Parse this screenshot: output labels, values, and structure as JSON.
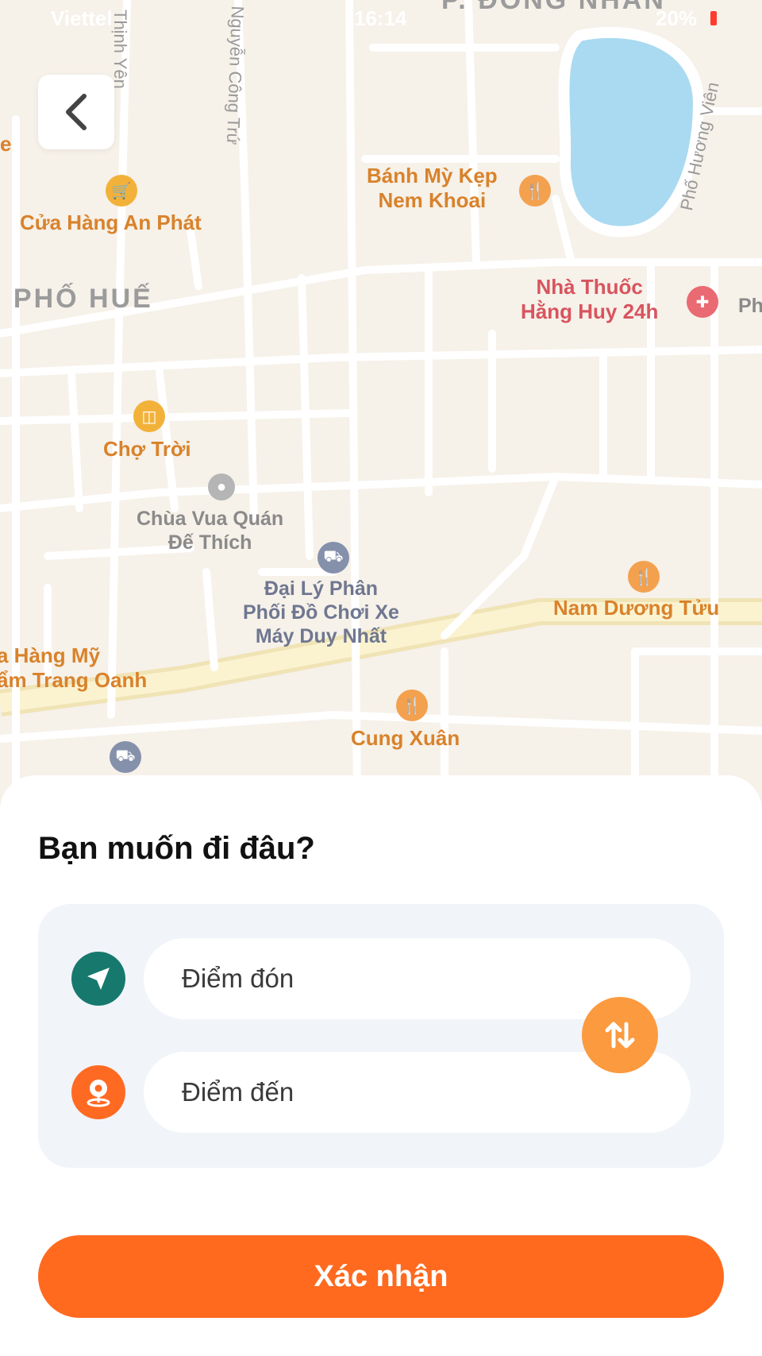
{
  "status_bar": {
    "carrier": "Viettel",
    "time": "16:14",
    "battery": "20%"
  },
  "map": {
    "labels": {
      "district_north": "P. ĐỒNG NHÂN",
      "district_west": ". PHỐ HUẾ",
      "street_thinh_yen": "Thịnh Yên",
      "street_nguyen_cong_tru": "Nguyễn Công Trứ",
      "street_huong_vien": "Phố Hương Viên",
      "edge_left_e": "e",
      "edge_right_ph": "Ph",
      "poi_an_phat": "Cửa Hàng An Phát",
      "poi_banh_my": "Bánh Mỳ Kẹp\nNem Khoai",
      "poi_nha_thuoc": "Nhà Thuốc\nHằng Huy 24h",
      "poi_cho_troi": "Chợ Trời",
      "poi_chua": "Chùa Vua Quán\nĐế Thích",
      "poi_dai_ly": "Đại Lý Phân\nPhối Đồ Chơi Xe\nMáy Duy Nhất",
      "poi_nam_duong": "Nam Dương Tửu",
      "poi_hang_my": "a Hàng Mỹ\nẩm Trang Oanh",
      "poi_cung_xuan": "Cung Xuân"
    }
  },
  "back_button": {
    "icon": "chevron-left-icon"
  },
  "sheet": {
    "title": "Bạn muốn đi đâu?",
    "pickup": {
      "placeholder": "Điểm đón",
      "value": "",
      "icon": "navigation-arrow-icon"
    },
    "destination": {
      "placeholder": "Điểm đến",
      "value": "",
      "icon": "location-pin-icon"
    },
    "swap_icon": "swap-arrows-icon",
    "confirm_label": "Xác nhận"
  },
  "colors": {
    "accent": "#ff6a1f",
    "pickup_icon_bg": "#17796d",
    "destination_icon_bg": "#ff6a23",
    "swap_bg": "#fb9a3f",
    "lake": "#a9daf1",
    "map_bg": "#f6f1e9"
  }
}
